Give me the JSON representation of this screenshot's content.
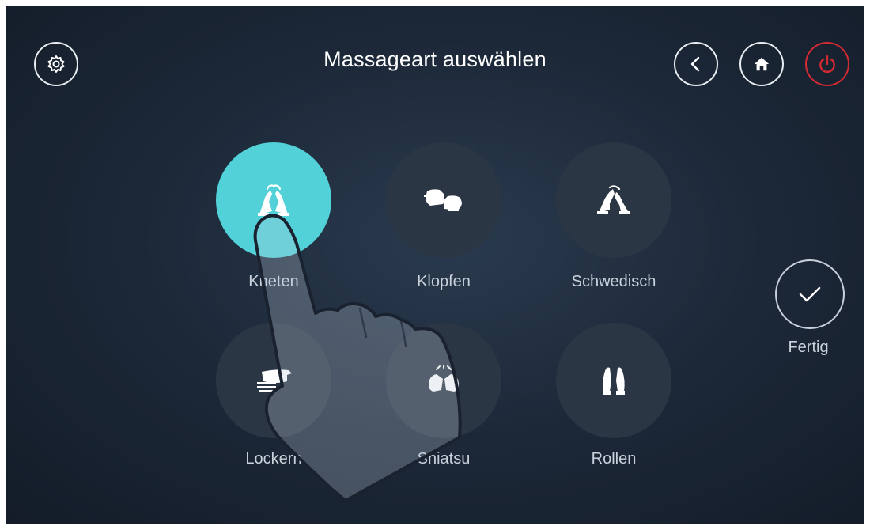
{
  "header": {
    "title": "Massageart auswählen"
  },
  "modes": [
    {
      "label": "Kneten",
      "icon": "kneading-hands-icon",
      "selected": true
    },
    {
      "label": "Klopfen",
      "icon": "tapping-fists-icon",
      "selected": false
    },
    {
      "label": "Schwedisch",
      "icon": "swedish-hands-icon",
      "selected": false
    },
    {
      "label": "Lockern",
      "icon": "loosening-hand-icon",
      "selected": false
    },
    {
      "label": "Shiatsu",
      "icon": "shiatsu-hands-icon",
      "selected": false
    },
    {
      "label": "Rollen",
      "icon": "rolling-hands-icon",
      "selected": false
    }
  ],
  "confirm": {
    "label": "Fertig"
  },
  "colors": {
    "accent": "#52d1d9",
    "power": "#d42a32",
    "background": "#1c2838",
    "button": "#2b3644"
  }
}
